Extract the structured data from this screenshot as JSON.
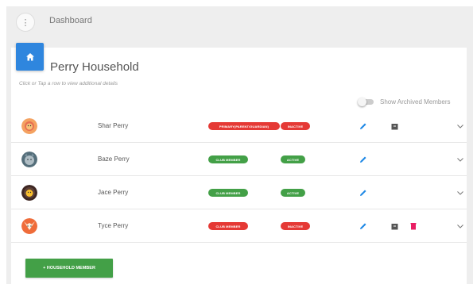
{
  "topbar": {
    "menu_label": "⋮",
    "title": "Dashboard"
  },
  "household": {
    "title": "Perry Household",
    "hint": "Click or Tap a row to view additional details",
    "show_archived_label": "Show Archived Members",
    "show_archived_on": false
  },
  "members": [
    {
      "name": "Shar Perry",
      "role_badge": "PRIMARY(PARENT/GUARDIAN)",
      "role_color": "#e53935",
      "status_badge": "INACTIVE",
      "status_color": "#e53935",
      "avatar": "lion-avatar",
      "actions": [
        "edit",
        "archive"
      ]
    },
    {
      "name": "Baze Perry",
      "role_badge": "CLUB MEMBER",
      "role_color": "#43a047",
      "status_badge": "ACTIVE",
      "status_color": "#43a047",
      "avatar": "wolf-avatar",
      "actions": [
        "edit"
      ]
    },
    {
      "name": "Jace Perry",
      "role_badge": "CLUB MEMBER",
      "role_color": "#43a047",
      "status_badge": "ACTIVE",
      "status_color": "#43a047",
      "avatar": "lion-avatar",
      "actions": [
        "edit"
      ]
    },
    {
      "name": "Tyce Perry",
      "role_badge": "CLUB MEMBER",
      "role_color": "#e53935",
      "status_badge": "INACTIVE",
      "status_color": "#e53935",
      "avatar": "fox-avatar",
      "actions": [
        "edit",
        "archive",
        "delete"
      ]
    }
  ],
  "add_button": {
    "label": "+ HOUSEHOLD MEMBER"
  },
  "colors": {
    "primary_blue": "#2f86de",
    "green": "#43a047",
    "red": "#e53935",
    "edit_icon": "#1e88e5"
  }
}
